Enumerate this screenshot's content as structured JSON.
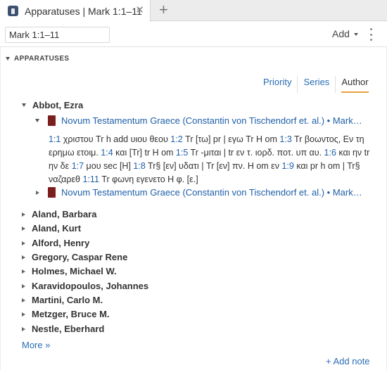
{
  "tab": {
    "title": "Apparatuses | Mark 1:1–11",
    "close": "✕",
    "add": "+"
  },
  "toolbar": {
    "reference_value": "Mark 1:1–11",
    "add_label": "Add"
  },
  "section": {
    "label": "APPARATUSES"
  },
  "sort_tabs": [
    {
      "label": "Priority",
      "active": false
    },
    {
      "label": "Series",
      "active": false
    },
    {
      "label": "Author",
      "active": true
    }
  ],
  "authors": [
    {
      "name": "Abbot, Ezra",
      "expanded": true
    },
    {
      "name": "Aland, Barbara"
    },
    {
      "name": "Aland, Kurt"
    },
    {
      "name": "Alford, Henry"
    },
    {
      "name": "Gregory, Caspar Rene"
    },
    {
      "name": "Holmes, Michael W."
    },
    {
      "name": "Karavidopoulos, Johannes"
    },
    {
      "name": "Martini, Carlo M."
    },
    {
      "name": "Metzger, Bruce M."
    },
    {
      "name": "Nestle, Eberhard"
    }
  ],
  "resources": [
    {
      "title": "Novum Testamentum Graece (Constantin von Tischendorf et. al.) • Mark…",
      "expanded": true
    },
    {
      "title": "Novum Testamentum Graece (Constantin von Tischendorf et. al.) • Mark…",
      "expanded": false
    }
  ],
  "apparatus": {
    "segments": [
      {
        "ref": "1:1",
        "text": " χριστου Tr h add υιου θεου "
      },
      {
        "ref": "1:2",
        "text": " Tr [τω] pr | εγω Tr H om "
      },
      {
        "ref": "1:3",
        "text": " Tr βοωντος, Εν τη ερημω ετοιμ. "
      },
      {
        "ref": "1:4",
        "text": " και [Tr] tr H om "
      },
      {
        "ref": "1:5",
        "text": " Tr -μιται | tr εν τ. ιορδ. ποτ. υπ αυ. "
      },
      {
        "ref": "1:6",
        "text": " και ην tr ην δε "
      },
      {
        "ref": "1:7",
        "text": " μου sec [H] "
      },
      {
        "ref": "1:8",
        "text": " Tr§ [εν] υδατι | Tr [εν] πν. H om εν "
      },
      {
        "ref": "1:9",
        "text": " και pr h om | Tr§ ναζαρεθ "
      },
      {
        "ref": "1:11",
        "text": " Tr φωνη εγενετο H φ. [ε.]"
      }
    ]
  },
  "more_label": "More »",
  "add_note_label": "+ Add note"
}
